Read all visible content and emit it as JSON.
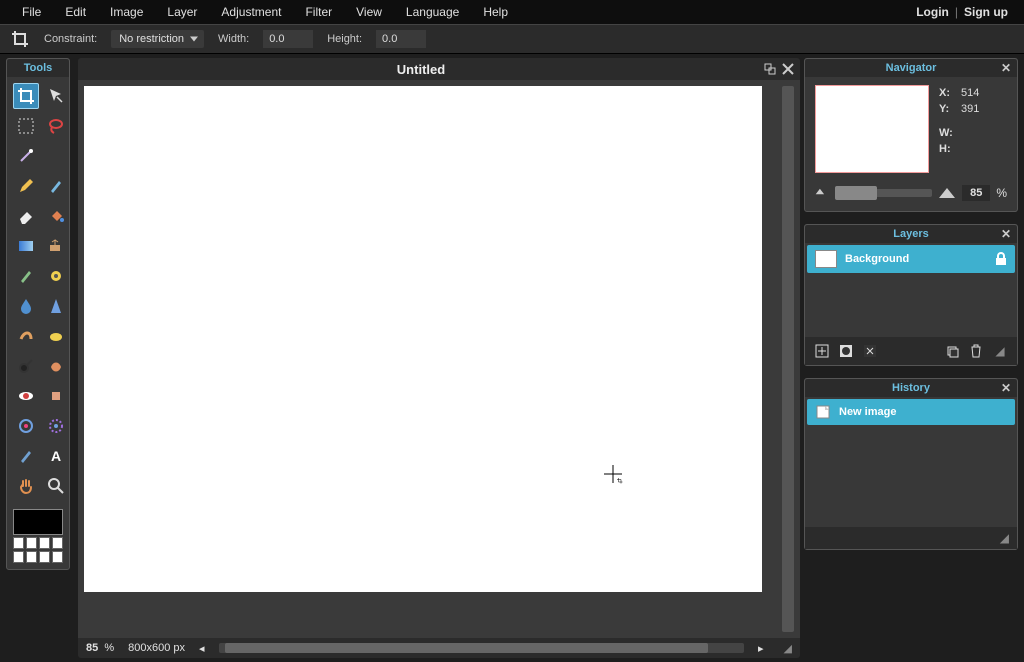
{
  "menu": [
    "File",
    "Edit",
    "Image",
    "Layer",
    "Adjustment",
    "Filter",
    "View",
    "Language",
    "Help"
  ],
  "auth": {
    "login": "Login",
    "signup": "Sign up"
  },
  "options": {
    "constraint_label": "Constraint:",
    "constraint_value": "No restriction",
    "width_label": "Width:",
    "width_value": "0.0",
    "height_label": "Height:",
    "height_value": "0.0"
  },
  "tools_panel_title": "Tools",
  "document": {
    "title": "Untitled",
    "zoom": "85",
    "zoom_suffix": "%",
    "dimensions": "800x600 px"
  },
  "navigator": {
    "title": "Navigator",
    "x_label": "X:",
    "y_label": "Y:",
    "w_label": "W:",
    "h_label": "H:",
    "x": "514",
    "y": "391",
    "w": "",
    "h": "",
    "zoom": "85",
    "zoom_suffix": "%"
  },
  "layers": {
    "title": "Layers",
    "items": [
      {
        "name": "Background",
        "locked": true
      }
    ]
  },
  "history": {
    "title": "History",
    "items": [
      {
        "name": "New image"
      }
    ]
  }
}
